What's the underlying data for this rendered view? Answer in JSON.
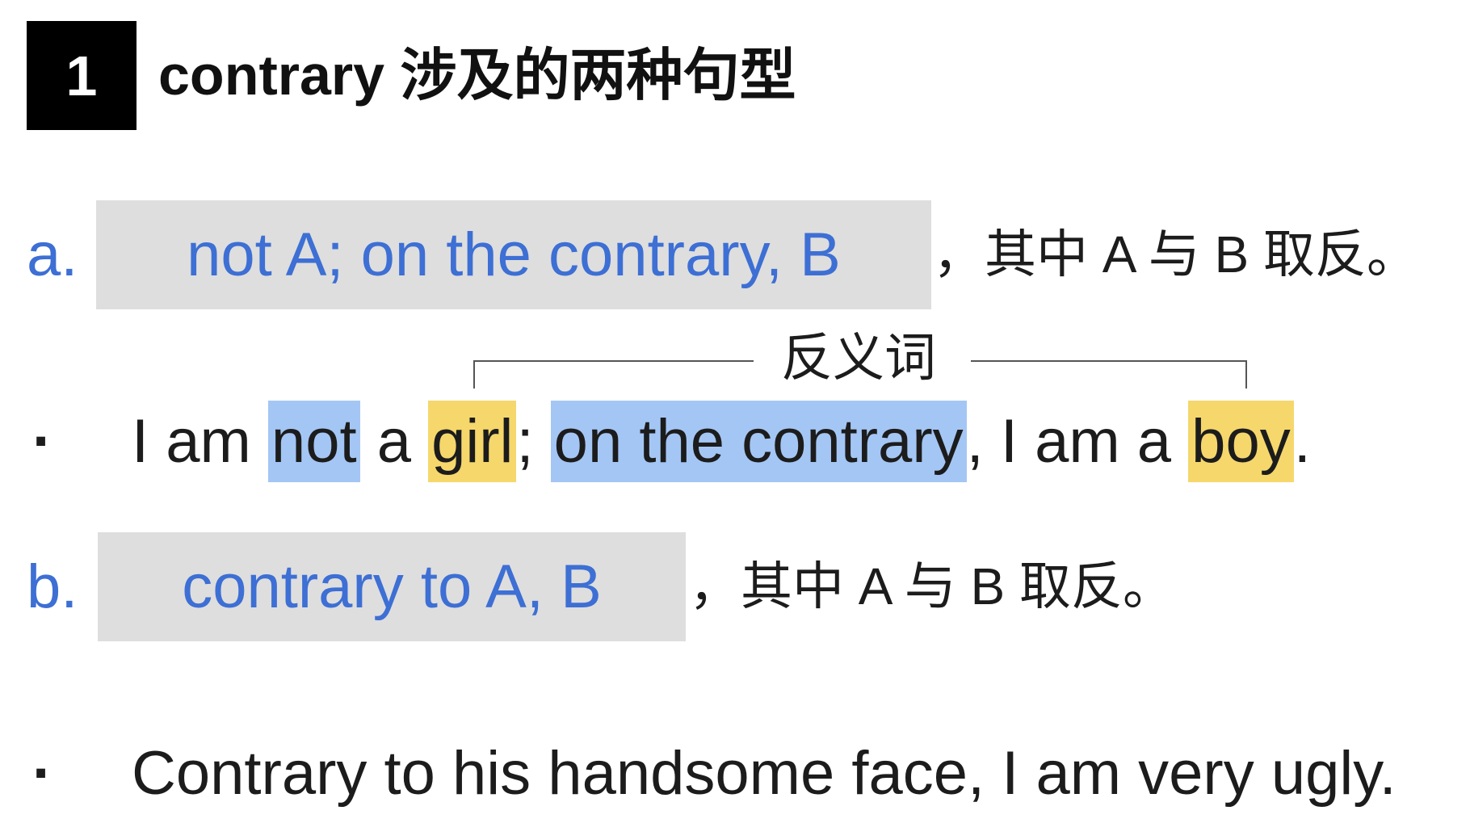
{
  "colors": {
    "accent_blue": "#3d6fd4",
    "formula_box_gray": "#dedede",
    "number_box_black": "#000000"
  },
  "section": {
    "number": "1",
    "title": "contrary 涉及的两种句型"
  },
  "pattern_a": {
    "label": "a.",
    "formula": "not A; on the contrary, B",
    "note": "，其中 A 与 B 取反。"
  },
  "antonym_bracket": {
    "label": "反义词"
  },
  "example_a": {
    "bullet": "·",
    "segments": [
      {
        "text": "I am ",
        "highlight": null
      },
      {
        "text": "not",
        "highlight": "#a4c6f4"
      },
      {
        "text": " a ",
        "highlight": null
      },
      {
        "text": "girl",
        "highlight": "#f5d76c"
      },
      {
        "text": "; ",
        "highlight": null
      },
      {
        "text": "on the contrary",
        "highlight": "#a4c6f4"
      },
      {
        "text": ", I am a ",
        "highlight": null
      },
      {
        "text": "boy",
        "highlight": "#f5d76c"
      },
      {
        "text": ".",
        "highlight": null
      }
    ]
  },
  "pattern_b": {
    "label": "b.",
    "formula": "contrary to A, B",
    "note": "，其中 A 与 B 取反。"
  },
  "example_b": {
    "bullet": "·",
    "text": "Contrary to his handsome face, I am very ugly."
  }
}
